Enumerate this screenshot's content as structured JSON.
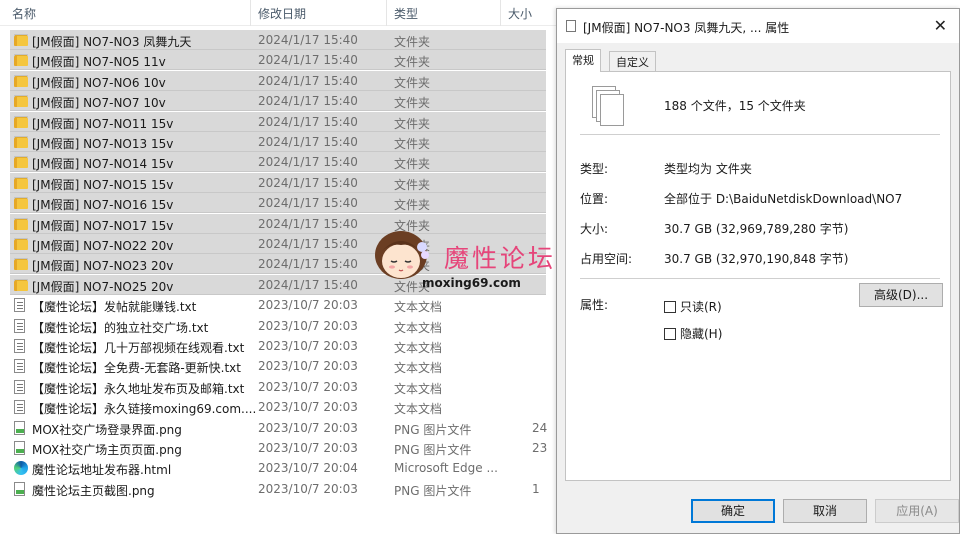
{
  "explorer": {
    "columns": {
      "name": "名称",
      "date": "修改日期",
      "type": "类型",
      "size": "大小"
    },
    "rows": [
      {
        "icon": "folder-icon",
        "name": "[JM假面] NO7-NO3 凤舞九天",
        "date": "2024/1/17 15:40",
        "type": "文件夹",
        "size": "",
        "selected": true
      },
      {
        "icon": "folder-icon",
        "name": "[JM假面] NO7-NO5 11v",
        "date": "2024/1/17 15:40",
        "type": "文件夹",
        "size": "",
        "selected": true
      },
      {
        "icon": "folder-icon",
        "name": "[JM假面] NO7-NO6 10v",
        "date": "2024/1/17 15:40",
        "type": "文件夹",
        "size": "",
        "selected": true
      },
      {
        "icon": "folder-icon",
        "name": "[JM假面] NO7-NO7 10v",
        "date": "2024/1/17 15:40",
        "type": "文件夹",
        "size": "",
        "selected": true
      },
      {
        "icon": "folder-icon",
        "name": "[JM假面] NO7-NO11 15v",
        "date": "2024/1/17 15:40",
        "type": "文件夹",
        "size": "",
        "selected": true
      },
      {
        "icon": "folder-icon",
        "name": "[JM假面] NO7-NO13 15v",
        "date": "2024/1/17 15:40",
        "type": "文件夹",
        "size": "",
        "selected": true
      },
      {
        "icon": "folder-icon",
        "name": "[JM假面] NO7-NO14 15v",
        "date": "2024/1/17 15:40",
        "type": "文件夹",
        "size": "",
        "selected": true
      },
      {
        "icon": "folder-icon",
        "name": "[JM假面] NO7-NO15 15v",
        "date": "2024/1/17 15:40",
        "type": "文件夹",
        "size": "",
        "selected": true
      },
      {
        "icon": "folder-icon",
        "name": "[JM假面] NO7-NO16 15v",
        "date": "2024/1/17 15:40",
        "type": "文件夹",
        "size": "",
        "selected": true
      },
      {
        "icon": "folder-icon",
        "name": "[JM假面] NO7-NO17 15v",
        "date": "2024/1/17 15:40",
        "type": "文件夹",
        "size": "",
        "selected": true
      },
      {
        "icon": "folder-icon",
        "name": "[JM假面] NO7-NO22 20v",
        "date": "2024/1/17 15:40",
        "type": "文件夹",
        "size": "",
        "selected": true
      },
      {
        "icon": "folder-icon",
        "name": "[JM假面] NO7-NO23 20v",
        "date": "2024/1/17 15:40",
        "type": "文件夹",
        "size": "",
        "selected": true
      },
      {
        "icon": "folder-icon",
        "name": "[JM假面] NO7-NO25 20v",
        "date": "2024/1/17 15:40",
        "type": "文件夹",
        "size": "",
        "selected": true
      },
      {
        "icon": "text-file-icon",
        "name": "【魔性论坛】发帖就能赚钱.txt",
        "date": "2023/10/7 20:03",
        "type": "文本文档",
        "size": "",
        "selected": false
      },
      {
        "icon": "text-file-icon",
        "name": "【魔性论坛】的独立社交广场.txt",
        "date": "2023/10/7 20:03",
        "type": "文本文档",
        "size": "",
        "selected": false
      },
      {
        "icon": "text-file-icon",
        "name": "【魔性论坛】几十万部视频在线观看.txt",
        "date": "2023/10/7 20:03",
        "type": "文本文档",
        "size": "",
        "selected": false
      },
      {
        "icon": "text-file-icon",
        "name": "【魔性论坛】全免费-无套路-更新快.txt",
        "date": "2023/10/7 20:03",
        "type": "文本文档",
        "size": "",
        "selected": false
      },
      {
        "icon": "text-file-icon",
        "name": "【魔性论坛】永久地址发布页及邮箱.txt",
        "date": "2023/10/7 20:03",
        "type": "文本文档",
        "size": "",
        "selected": false
      },
      {
        "icon": "text-file-icon",
        "name": "【魔性论坛】永久链接moxing69.com....",
        "date": "2023/10/7 20:03",
        "type": "文本文档",
        "size": "",
        "selected": false
      },
      {
        "icon": "png-file-icon",
        "name": "MOX社交广场登录界面.png",
        "date": "2023/10/7 20:03",
        "type": "PNG 图片文件",
        "size": "24",
        "selected": false
      },
      {
        "icon": "png-file-icon",
        "name": "MOX社交广场主页页面.png",
        "date": "2023/10/7 20:03",
        "type": "PNG 图片文件",
        "size": "23",
        "selected": false
      },
      {
        "icon": "edge-html-icon",
        "name": "魔性论坛地址发布器.html",
        "date": "2023/10/7 20:04",
        "type": "Microsoft Edge ...",
        "size": "",
        "selected": false
      },
      {
        "icon": "png-file-icon",
        "name": "魔性论坛主页截图.png",
        "date": "2023/10/7 20:03",
        "type": "PNG 图片文件",
        "size": "1",
        "selected": false
      }
    ]
  },
  "watermark": {
    "title": "魔性论坛",
    "url": "moxing69.com"
  },
  "dialog": {
    "title": "[JM假面] NO7-NO3 凤舞九天, ... 属性",
    "close": "✕",
    "tabs": [
      "常规",
      "自定义"
    ],
    "summary": "188 个文件，15 个文件夹",
    "fields": [
      {
        "label": "类型:",
        "value": "类型均为 文件夹"
      },
      {
        "label": "位置:",
        "value": "全部位于 D:\\BaiduNetdiskDownload\\NO7"
      },
      {
        "label": "大小:",
        "value": "30.7 GB (32,969,789,280 字节)"
      },
      {
        "label": "占用空间:",
        "value": "30.7 GB (32,970,190,848 字节)"
      }
    ],
    "attributes_label": "属性:",
    "readonly_label": "只读(R)",
    "hidden_label": "隐藏(H)",
    "advanced_label": "高级(D)...",
    "ok_label": "确定",
    "cancel_label": "取消",
    "apply_label": "应用(A)"
  }
}
